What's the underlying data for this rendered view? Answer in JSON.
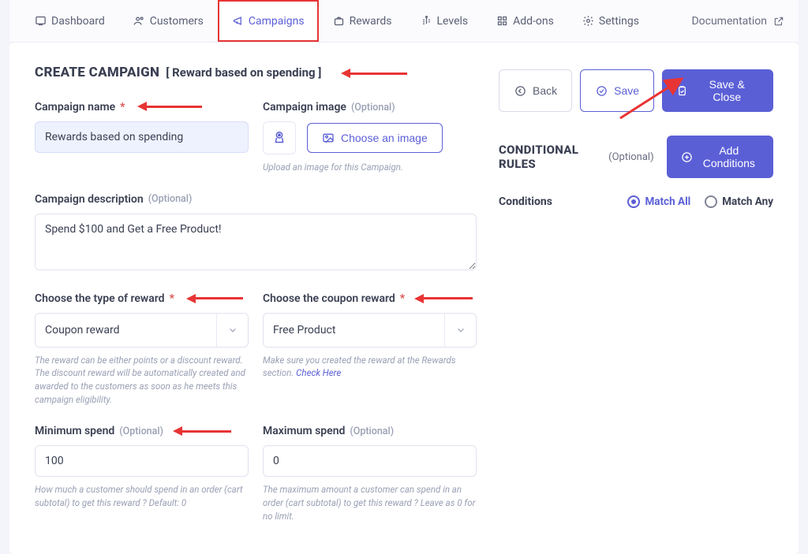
{
  "nav": {
    "items": [
      {
        "label": "Dashboard",
        "icon": "dashboard-icon"
      },
      {
        "label": "Customers",
        "icon": "customers-icon"
      },
      {
        "label": "Campaigns",
        "icon": "campaigns-icon",
        "active": true
      },
      {
        "label": "Rewards",
        "icon": "rewards-icon"
      },
      {
        "label": "Levels",
        "icon": "levels-icon"
      },
      {
        "label": "Add-ons",
        "icon": "addons-icon"
      },
      {
        "label": "Settings",
        "icon": "settings-icon"
      }
    ],
    "doc": "Documentation"
  },
  "header": {
    "title": "CREATE CAMPAIGN",
    "subtitle": "[ Reward based on spending ]",
    "back": "Back",
    "save": "Save",
    "save_close": "Save & Close"
  },
  "form": {
    "name_label": "Campaign name",
    "name_value": "Rewards based on spending",
    "image_label": "Campaign image",
    "image_optional": "(Optional)",
    "choose_image": "Choose an image",
    "image_help": "Upload an image for this Campaign.",
    "desc_label": "Campaign description",
    "desc_optional": "(Optional)",
    "desc_value": "Spend $100 and Get a Free Product!",
    "reward_type_label": "Choose the type of reward",
    "reward_type_value": "Coupon reward",
    "reward_type_help": "The reward can be either points or a discount reward. The discount reward will be automatically created and awarded to the customers as soon as he meets this campaign eligibility.",
    "coupon_label": "Choose the coupon reward",
    "coupon_value": "Free Product",
    "coupon_help_text": "Make sure you created the reward at the Rewards section.",
    "coupon_help_link": "Check Here",
    "min_label": "Minimum spend",
    "min_optional": "(Optional)",
    "min_value": "100",
    "min_help": "How much a customer should spend in an order (cart subtotal) to get this reward ? Default: 0",
    "max_label": "Maximum spend",
    "max_optional": "(Optional)",
    "max_value": "0",
    "max_help": "The maximum amount a customer can spend in an order (cart subtotal) to get this reward ? Leave as 0 for no limit."
  },
  "conditions": {
    "title": "CONDITIONAL RULES",
    "optional": "(Optional)",
    "add": "Add Conditions",
    "label": "Conditions",
    "match_all": "Match All",
    "match_any": "Match Any",
    "selected": "all"
  }
}
